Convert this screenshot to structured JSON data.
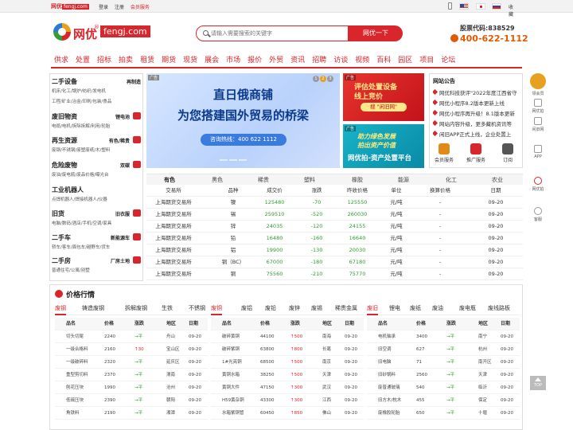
{
  "topbar": {
    "brand": "网优",
    "brand_domain": "fengj.com",
    "links": [
      "登录",
      "注册",
      "会员服务"
    ],
    "favorite": "收藏"
  },
  "header": {
    "logo_cn": "网优",
    "logo_reg": "®",
    "logo_domain": "fengj.com",
    "search_placeholder": "请输入需要搜索的关键字",
    "search_button": "网优一下",
    "stock_code": "股票代码:838529",
    "hotline": "400-622-1112"
  },
  "nav": [
    "供求",
    "处置",
    "招标",
    "拍卖",
    "租赁",
    "期货",
    "现货",
    "展会",
    "市场",
    "报价",
    "外贸",
    "资讯",
    "招聘",
    "访谈",
    "视频",
    "百科",
    "园区",
    "项目",
    "论坛"
  ],
  "categories": [
    {
      "title": "二手设备",
      "right": "再制造",
      "sub1": "机床/化工/锅炉/纺织/发电机",
      "sub2": "工程/矿业/冶金/印刷/包装/食品"
    },
    {
      "title": "废旧物资",
      "right": "锂电池",
      "sub1": "电缆/电机/拆除拆解/利用/轮胎",
      "sub2": ""
    },
    {
      "title": "再生资源",
      "right": "有色/稀贵",
      "sub1": "废钢/不锈钢/废塑废纸/木/塑料",
      "sub2": ""
    },
    {
      "title": "危险废物",
      "right": "双碳",
      "sub1": "废油/废电瓶/废品价格/曝光台",
      "sub2": ""
    },
    {
      "title": "工业机器人",
      "right": "",
      "sub1": "点焊机器人/焊接机器人/仪器",
      "sub2": ""
    },
    {
      "title": "旧货",
      "right": "旧衣服",
      "sub1": "电脑/数码/酒店/手机/空调/家具",
      "sub2": ""
    },
    {
      "title": "二手车",
      "right": "新能源车",
      "sub1": "轿车/客车/面包车/越野车/货车",
      "sub2": ""
    },
    {
      "title": "二手房",
      "right": "厂房土地",
      "sub1": "普通住宅/公寓/别墅",
      "sub2": ""
    }
  ],
  "banner_main": {
    "tag": "广告",
    "line1": "直日俄商铺",
    "line2": "为您搭建国外贸易的桥梁",
    "hotline": "咨询热线：400 622 1112",
    "pager": [
      "1",
      "2",
      "3"
    ]
  },
  "banner_red": {
    "tag": "广告",
    "line1": "评估处置设备",
    "line2": "线上竞价",
    "button": "搜 \"闲旧网\""
  },
  "banner_teal": {
    "tag": "广告",
    "line1": "助力绿色发展",
    "line2": "拍出资产价值",
    "line3": "网优拍-资产处置平台"
  },
  "notice": {
    "title": "网站公告",
    "items": [
      "网优科技获评\"2022年度江西省守",
      "网优小程序8.2版本更新上线",
      "网优小程序再升级！8.1版本更新",
      "网站内容升级，更多藏机资讯等",
      "闲旧APP正式上线，企业处置上"
    ]
  },
  "quick_icons": [
    {
      "label": "会员服务",
      "color": "#e08a1a"
    },
    {
      "label": "推广服务",
      "color": "#d9262c"
    },
    {
      "label": "订阅",
      "color": "#555555"
    }
  ],
  "futures": {
    "tabs": [
      "有色",
      "黑色",
      "稀贵",
      "塑料",
      "橡胶",
      "能源",
      "化工",
      "农业"
    ],
    "headers": [
      "交易所",
      "品种",
      "成交价",
      "涨跌",
      "昨收价格",
      "单位",
      "换算价格",
      "日期"
    ],
    "rows": [
      [
        "上海期货交易所",
        "镍",
        "125480",
        "-70",
        "125550",
        "元/吨",
        "-",
        "09-20"
      ],
      [
        "上海期货交易所",
        "锡",
        "259510",
        "-520",
        "260030",
        "元/吨",
        "-",
        "09-20"
      ],
      [
        "上海期货交易所",
        "锌",
        "24035",
        "-120",
        "24155",
        "元/吨",
        "-",
        "09-20"
      ],
      [
        "上海期货交易所",
        "铅",
        "16480",
        "-160",
        "16640",
        "元/吨",
        "-",
        "09-20"
      ],
      [
        "上海期货交易所",
        "铝",
        "19900",
        "-130",
        "20030",
        "元/吨",
        "-",
        "09-20"
      ],
      [
        "上海期货交易所",
        "铜（BC）",
        "67000",
        "-180",
        "67180",
        "元/吨",
        "-",
        "09-20"
      ],
      [
        "上海期货交易所",
        "铜",
        "75560",
        "-210",
        "75770",
        "元/吨",
        "-",
        "09-20"
      ]
    ]
  },
  "sidebar_right": [
    "领会员",
    "网优拍",
    "闲旧网",
    "APP",
    "网优拍",
    "客服"
  ],
  "back_top": "TOP",
  "price": {
    "title": "价格行情",
    "tab_groups": [
      [
        "废钢",
        "铸造废钢",
        "拆解废钢",
        "生铁",
        "不锈钢"
      ],
      [
        "废铜",
        "废铝",
        "废铅",
        "废锌",
        "废锡",
        "稀贵金属"
      ],
      [
        "废旧",
        "锂电",
        "废纸",
        "废油",
        "废电瓶",
        "废线路板"
      ]
    ],
    "headers": [
      "品名",
      "价格",
      "涨跌",
      "地区",
      "日期"
    ],
    "columns": [
      [
        [
          "切头切尾",
          "2240",
          "→平",
          "舟山",
          "09-20",
          "flat"
        ],
        [
          "一级合格料",
          "2160",
          "↑30",
          "宝山区",
          "09-20",
          "up"
        ],
        [
          "一级破碎料",
          "2320",
          "→平",
          "延庆区",
          "09-20",
          "flat"
        ],
        [
          "重型剪切料",
          "2370",
          "→平",
          "渭南",
          "09-20",
          "flat"
        ],
        [
          "刨花压块",
          "1990",
          "→平",
          "沧州",
          "09-20",
          "flat"
        ],
        [
          "低硫压块",
          "2390",
          "→平",
          "朝阳",
          "09-20",
          "flat"
        ],
        [
          "角铁料",
          "2190",
          "→平",
          "湘潭",
          "09-20",
          "flat"
        ]
      ],
      [
        [
          "破碎黄铜",
          "44100",
          "↑500",
          "南海",
          "09-20",
          "up"
        ],
        [
          "破碎紫铜",
          "63800",
          "↑800",
          "长葛",
          "09-20",
          "up"
        ],
        [
          "1#光亮铜",
          "68500",
          "↑500",
          "南京",
          "09-20",
          "up"
        ],
        [
          "黄铜水箱",
          "38250",
          "↑500",
          "天津",
          "09-20",
          "up"
        ],
        [
          "黄铜大件",
          "47150",
          "↑300",
          "武汉",
          "09-20",
          "up"
        ],
        [
          "H59黄杂铜",
          "43300",
          "↑300",
          "江西",
          "09-20",
          "up"
        ],
        [
          "水箱紫铜管",
          "60450",
          "↑850",
          "佛山",
          "09-20",
          "up"
        ]
      ],
      [
        [
          "电机轴承",
          "3400",
          "→平",
          "南宁",
          "09-20",
          "flat"
        ],
        [
          "旧空调",
          "627",
          "→平",
          "杭州",
          "09-20",
          "flat"
        ],
        [
          "旧电脑",
          "71",
          "→平",
          "南开区",
          "09-20",
          "flat"
        ],
        [
          "旧砂锅料",
          "2560",
          "→平",
          "天津",
          "09-20",
          "flat"
        ],
        [
          "废普通玻璃",
          "540",
          "→平",
          "临沂",
          "09-20",
          "flat"
        ],
        [
          "旧方木/枕木",
          "455",
          "→平",
          "保定",
          "09-20",
          "flat"
        ],
        [
          "废橡胶轮胎",
          "650",
          "→平",
          "十堰",
          "09-20",
          "flat"
        ]
      ]
    ]
  }
}
